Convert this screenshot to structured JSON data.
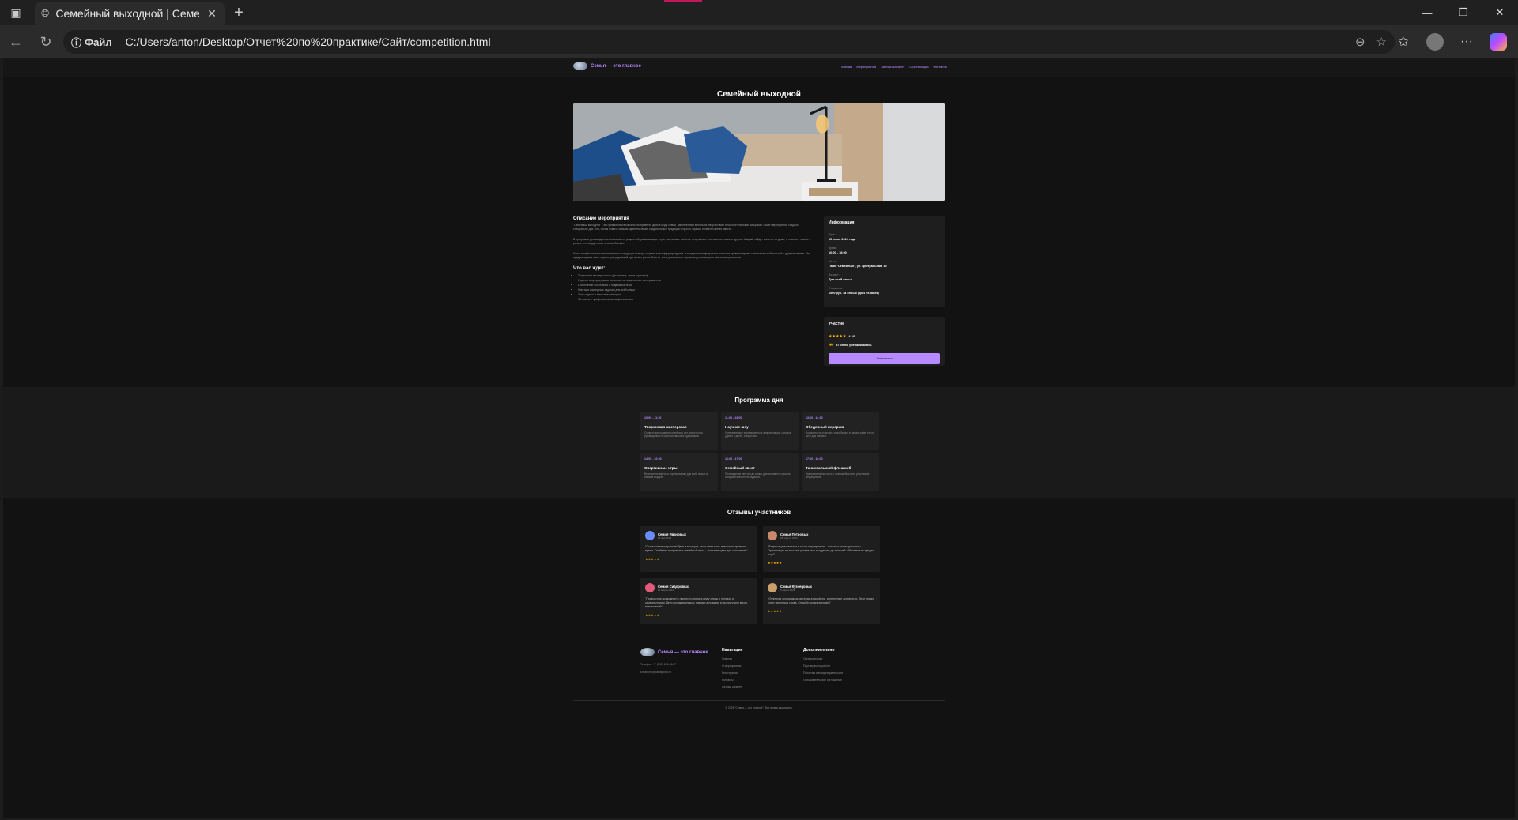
{
  "browser": {
    "tab_title": "Семейный выходной | Семейн",
    "address_prefix": "Файл",
    "url": "C:/Users/anton/Desktop/Отчет%20по%20практике/Сайт/competition.html"
  },
  "site": {
    "logo_text": "Семья — это главное",
    "nav": [
      "Главная",
      "Мероприятия",
      "Личный кабинет",
      "Организация",
      "Контакты"
    ]
  },
  "event": {
    "title": "Семейный выходной",
    "description_title": "Описание мероприятия",
    "paragraphs": [
      "\"Семейный выходной\" - это уникальная возможность провести день в кругу семьи, наполненный весельем, творчеством и положительными эмоциями. Наше мероприятие создано специально для того, чтобы помочь семьям укрепить связи, создать новые традиции и просто хорошо провести время вместе.",
      "В программе для каждого члена семьи от родителей, развивающие игры, творческие занятия, спортивные состязания и многое другое. Каждый найдет занятие по душе, а главное - сможет узнать что-нибудь новое о своих близких.",
      "Наши профессиональные аниматоры и ведущие помогут создать атмосферу праздника, а продуманная программа позволит провести время с максимальной пользой и удовольствием. Мы предусмотрели зоны отдыха для родителей, где можно расслабиться, пока дети заняты играми под присмотром наших специалистов."
    ],
    "expect_title": "Что вас ждет:",
    "expect_items": [
      "Творческие мастер-классы (рисование, лепка, оригами)",
      "Научное шоу-программа на основе интерактивных экспериментов",
      "Спортивные состязания и подвижные игры",
      "Квесты и командные задания для всей семьи",
      "Зона отдыха и тематическая кухня",
      "Фотозона и профессиональная фотосъемка"
    ]
  },
  "info": {
    "title": "Информация",
    "rows": [
      {
        "label": "Дата:",
        "value": "15 июня 2024 года"
      },
      {
        "label": "Время:",
        "value": "10:00 - 18:00"
      },
      {
        "label": "Место:",
        "value": "Парк \"Семейный\", ул. Центральная, 10"
      },
      {
        "label": "Возраст:",
        "value": "Для всей семьи"
      },
      {
        "label": "Стоимость:",
        "value": "1500 руб. за семью (до 4 человек)"
      }
    ]
  },
  "participants": {
    "title": "Участие",
    "stars": "★★★★★",
    "rating": "4.8/5",
    "people_icon": "people-icon",
    "people_text": "87 семей уже записались",
    "join_label": "Записаться"
  },
  "program": {
    "title": "Программа дня",
    "items": [
      {
        "time": "10:00 - 11:30",
        "name": "Творческая мастерская",
        "desc": "Совместное создание семейного арт-проекта под руководством профессиональных художников."
      },
      {
        "time": "11:30 - 13:00",
        "name": "Научное шоу",
        "desc": "Увлекательные эксперименты и демонстрации, которые удивят и детей, и взрослых."
      },
      {
        "time": "13:00 - 14:00",
        "name": "Обеденный перерыв",
        "desc": "Возможность отдохнуть и пообедать в нашем кафе или на зоне для пикника."
      },
      {
        "time": "14:00 - 16:00",
        "name": "Спортивные игры",
        "desc": "Веселые эстафеты и соревнования для всей семьи на свежем воздухе."
      },
      {
        "time": "16:00 - 17:00",
        "name": "Семейный квест",
        "desc": "Прохождение квеста, где семьи должны вместе решать загадки и выполнять задания."
      },
      {
        "time": "17:00 - 18:00",
        "name": "Танцевальный флешмоб",
        "desc": "Заключительная часть с флешмобом всех участников мероприятия."
      }
    ]
  },
  "reviews": {
    "title": "Отзывы участников",
    "items": [
      {
        "name": "Семья Ивановых",
        "date": "15 мая 2024",
        "text": "\"Отличное мероприятие! Дети в восторге, мы и сами тоже прекрасно провели время. Особенно понравился семейный квест - отличная идея для сплочения.\"",
        "stars": "★★★★★",
        "color": "#6b8cff"
      },
      {
        "name": "Семья Петровых",
        "date": "28 апреля 2024",
        "text": "\"Впервые участвовали в таком мероприятии - остались очень довольны. Организация на высшем уровне, все продумано до мелочей. Обязательно придем еще!\"",
        "stars": "★★★★★",
        "color": "#c98a6b"
      },
      {
        "name": "Семья Сидоровых",
        "date": "10 марта 2024",
        "text": "\"Прекрасная возможность провести время в кругу семьи с пользой и удовольствием. Дети познакомились с новыми друзьями, а мы получили много впечатлений.\"",
        "stars": "★★★★★",
        "color": "#e05a7a"
      },
      {
        "name": "Семья Кузнецовых",
        "date": "5 марта 2024",
        "text": "\"Отличная организация, веселая атмосфера, интересные активности. Дети прямо хотят вернуться снова. Спасибо организаторам!\"",
        "stars": "★★★★★",
        "color": "#c9a06b"
      }
    ]
  },
  "footer": {
    "logo_text": "Семья — это главное",
    "phone": "Телефон: +7 (900) 123-45-67",
    "email": "Email: info@family-first.ru",
    "nav_title": "Навигация",
    "nav_links": [
      "Главная",
      "О мероприятии",
      "Регистрация",
      "Контакты",
      "Личный кабинет"
    ],
    "extra_title": "Дополнительно",
    "extra_links": [
      "Организаторам",
      "Партнерам по работе",
      "Политика конфиденциальности",
      "Пользовательское соглашение"
    ],
    "copyright": "© 2024 \"Семья — это главное\". Все права защищены."
  }
}
